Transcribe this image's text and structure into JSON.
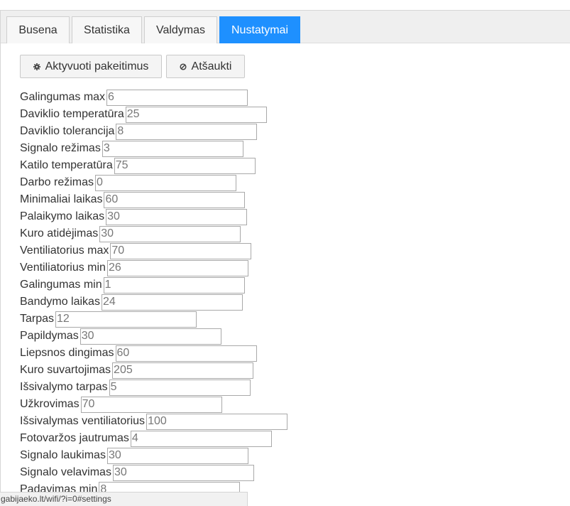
{
  "tabs": [
    {
      "label": "Busena",
      "active": false
    },
    {
      "label": "Statistika",
      "active": false
    },
    {
      "label": "Valdymas",
      "active": false
    },
    {
      "label": "Nustatymai",
      "active": true
    }
  ],
  "actions": {
    "apply_label": "Aktyvuoti pakeitimus",
    "apply_icon": "gear-icon",
    "cancel_label": "Atšaukti",
    "cancel_icon": "cancel-icon"
  },
  "settings": [
    {
      "label": "Galingumas max",
      "value": "6"
    },
    {
      "label": "Daviklio temperatūra",
      "value": "25"
    },
    {
      "label": "Daviklio tolerancija",
      "value": "8"
    },
    {
      "label": "Signalo režimas",
      "value": "3"
    },
    {
      "label": "Katilo temperatūra",
      "value": "75"
    },
    {
      "label": "Darbo režimas",
      "value": "0"
    },
    {
      "label": "Minimaliai laikas",
      "value": "60"
    },
    {
      "label": "Palaikymo laikas",
      "value": "30"
    },
    {
      "label": "Kuro atidėjimas",
      "value": "30"
    },
    {
      "label": "Ventiliatorius max",
      "value": "70"
    },
    {
      "label": "Ventiliatorius min",
      "value": "26"
    },
    {
      "label": "Galingumas min",
      "value": "1"
    },
    {
      "label": "Bandymo laikas",
      "value": "24"
    },
    {
      "label": "Tarpas",
      "value": "12"
    },
    {
      "label": "Papildymas",
      "value": "30"
    },
    {
      "label": "Liepsnos dingimas",
      "value": "60"
    },
    {
      "label": "Kuro suvartojimas",
      "value": "205"
    },
    {
      "label": "Išsivalymo tarpas",
      "value": "5"
    },
    {
      "label": "Užkrovimas",
      "value": "70"
    },
    {
      "label": "Išsivalymas ventiliatorius",
      "value": "100"
    },
    {
      "label": "Fotovaržos jautrumas",
      "value": "4"
    },
    {
      "label": "Signalo laukimas",
      "value": "30"
    },
    {
      "label": "Signalo velavimas",
      "value": "30"
    },
    {
      "label": "Padavimas min",
      "value": "8"
    }
  ],
  "status_url": "gabijaeko.lt/wifi/?i=0#settings",
  "colors": {
    "active_tab": "#1e90ff",
    "tab_bar": "#efefef",
    "input_border": "#a9a9a9"
  }
}
